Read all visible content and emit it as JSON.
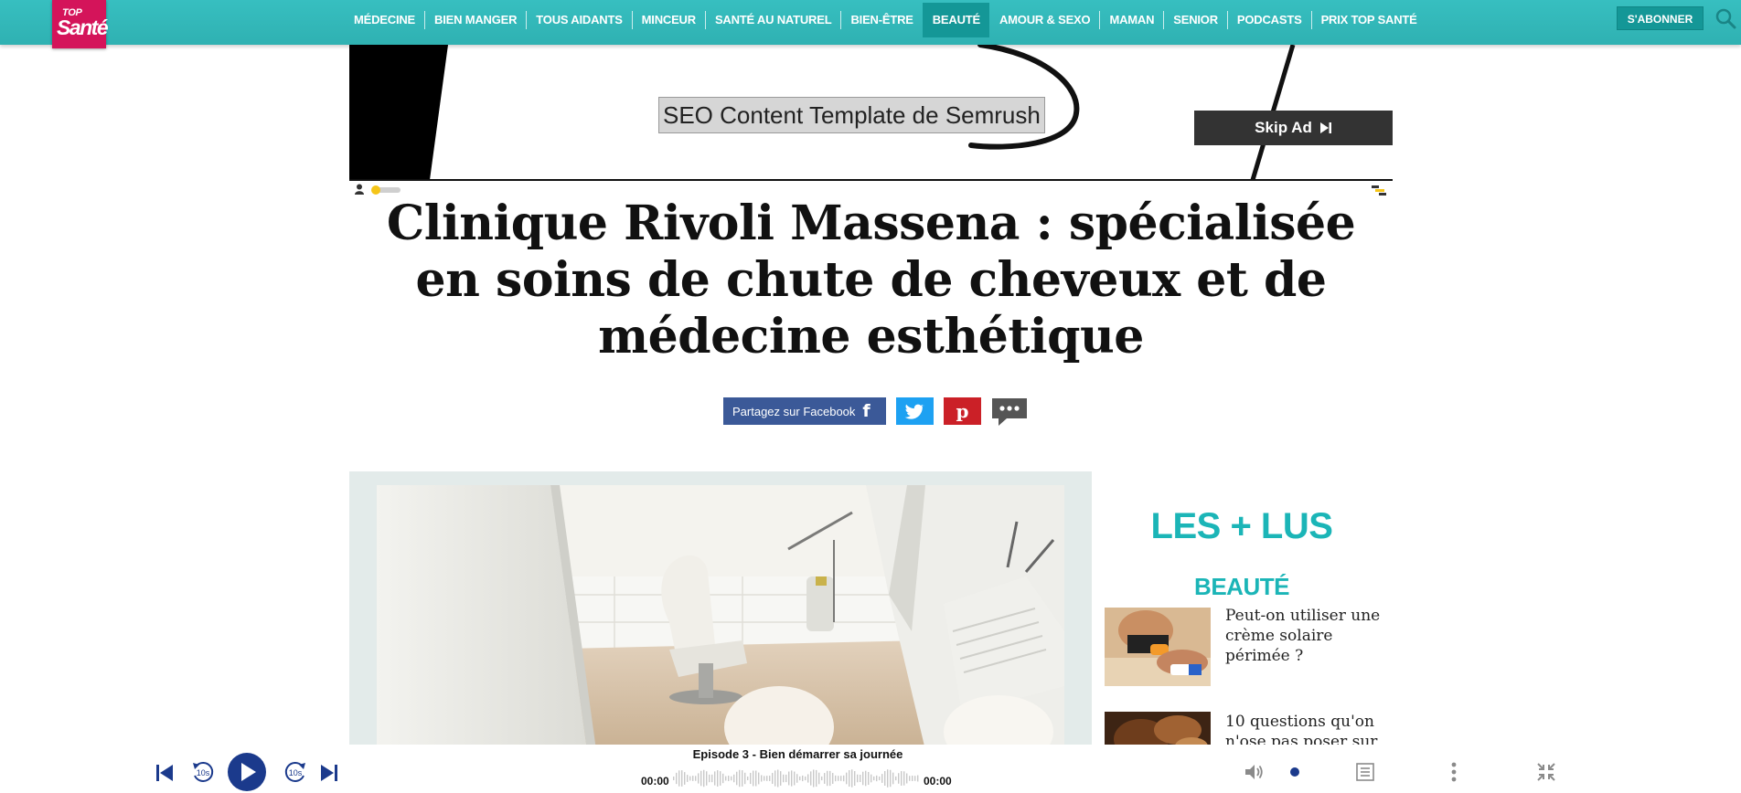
{
  "header": {
    "logo_top": "TOP",
    "logo_main": "Santé",
    "menu": [
      {
        "label": "MÉDECINE",
        "active": false
      },
      {
        "label": "BIEN MANGER",
        "active": false
      },
      {
        "label": "TOUS AIDANTS",
        "active": false
      },
      {
        "label": "MINCEUR",
        "active": false
      },
      {
        "label": "SANTÉ AU NATUREL",
        "active": false
      },
      {
        "label": "BIEN-ÊTRE",
        "active": false
      },
      {
        "label": "BEAUTÉ",
        "active": true
      },
      {
        "label": "AMOUR & SEXO",
        "active": false
      },
      {
        "label": "MAMAN",
        "active": false
      },
      {
        "label": "SENIOR",
        "active": false
      },
      {
        "label": "PODCASTS",
        "active": false
      },
      {
        "label": "PRIX TOP SANTÉ",
        "active": false
      }
    ],
    "subscribe_label": "S'ABONNER",
    "search_icon": "search-icon"
  },
  "ad": {
    "headline": "SEO Content Template de Semrush",
    "skip_label": "Skip Ad"
  },
  "article": {
    "title": "Clinique Rivoli Massena : spécialisée en soins de chute de cheveux et de médecine esthétique",
    "share_facebook_label": "Partagez sur Facebook",
    "share_icons": [
      "facebook-icon",
      "twitter-icon",
      "pinterest-icon",
      "comment-icon"
    ]
  },
  "sidebar": {
    "heading": "LES + LUS",
    "category": "BEAUTÉ",
    "items": [
      {
        "title": "Peut-on utiliser une crème solaire périmée ?"
      },
      {
        "title": "10 questions qu'on n'ose pas poser sur"
      }
    ]
  },
  "player": {
    "episode": "Episode 3 - Bien démarrer sa journée",
    "time_current": "00:00",
    "time_total": "00:00",
    "skip_seconds_label": "10s",
    "volume_level": 0.0
  },
  "colors": {
    "nav_teal": "#32b8b9",
    "nav_active": "#149797",
    "logo_pink": "#d4145a",
    "accent_teal": "#1bb5b7",
    "facebook": "#3b5998",
    "twitter": "#1da1f2",
    "pinterest": "#cb2027",
    "player_blue": "#1b3a8c"
  }
}
